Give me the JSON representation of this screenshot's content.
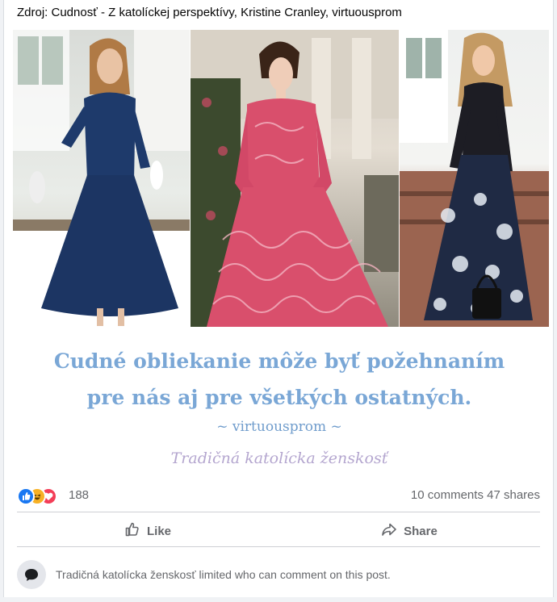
{
  "post": {
    "source": "Zdroj: Cudnosť - Z katolíckej perspektívy, Kristine Cranley, virtuousprom",
    "image": {
      "quote_line1": "Cudné obliekanie môže byť požehnaním",
      "quote_line2": "pre nás aj pre všetkých ostatných.",
      "attribution": "~ virtuousprom ~",
      "brand": "Tradičná katolícka ženskosť",
      "colors": {
        "quote": "#7aa7d6",
        "brand": "#b4a6cf"
      }
    },
    "stats": {
      "reaction_icons": [
        "like-icon",
        "haha-icon",
        "love-icon"
      ],
      "reaction_count": "188",
      "comments": "10 comments",
      "shares": "47 shares"
    },
    "actions": {
      "like_label": "Like",
      "share_label": "Share"
    },
    "restriction_notice": "Tradičná katolícka ženskosť limited who can comment on this post."
  }
}
